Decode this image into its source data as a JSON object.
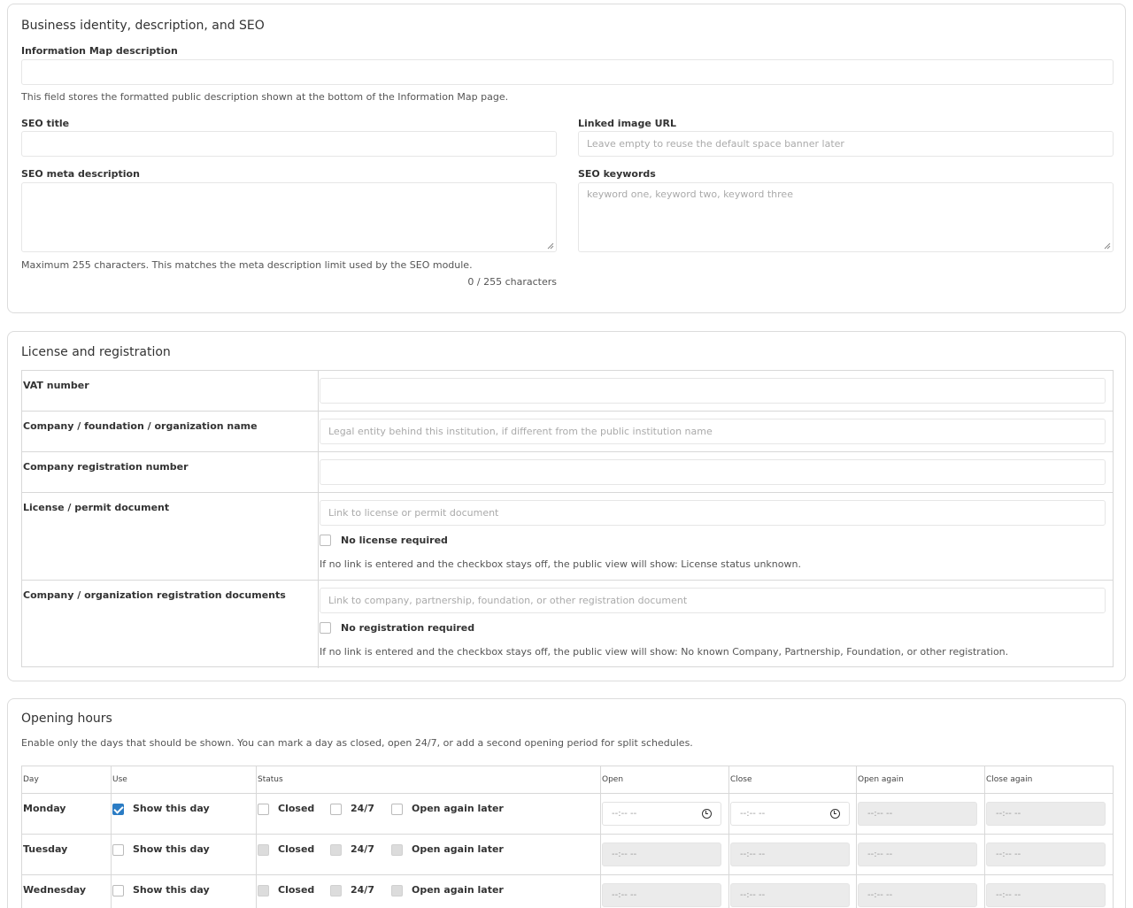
{
  "seo": {
    "title": "Business identity, description, and SEO",
    "info_map_label": "Information Map description",
    "info_map_value": "",
    "info_map_help": "This field stores the formatted public description shown at the bottom of the Information Map page.",
    "seo_title_label": "SEO title",
    "seo_title_value": "",
    "linked_image_label": "Linked image URL",
    "linked_image_placeholder": "Leave empty to reuse the default space banner later",
    "meta_desc_label": "SEO meta description",
    "meta_desc_value": "",
    "keywords_label": "SEO keywords",
    "keywords_placeholder": "keyword one, keyword two, keyword three",
    "meta_help": "Maximum 255 characters. This matches the meta description limit used by the SEO module.",
    "char_count": "0 / 255 characters"
  },
  "license": {
    "title": "License and registration",
    "rows": {
      "vat": {
        "label": "VAT number",
        "placeholder": ""
      },
      "company_name": {
        "label": "Company / foundation / organization name",
        "placeholder": "Legal entity behind this institution, if different from the public institution name"
      },
      "reg_number": {
        "label": "Company registration number",
        "placeholder": ""
      },
      "permit": {
        "label": "License / permit document",
        "placeholder": "Link to license or permit document",
        "checkbox": "No license required",
        "help": "If no link is entered and the checkbox stays off, the public view will show: License status unknown."
      },
      "reg_docs": {
        "label": "Company / organization registration documents",
        "placeholder": "Link to company, partnership, foundation, or other registration document",
        "checkbox": "No registration required",
        "help": "If no link is entered and the checkbox stays off, the public view will show: No known Company, Partnership, Foundation, or other registration."
      }
    }
  },
  "hours": {
    "title": "Opening hours",
    "help": "Enable only the days that should be shown. You can mark a day as closed, open 24/7, or add a second opening period for split schedules.",
    "headers": {
      "day": "Day",
      "use": "Use",
      "status": "Status",
      "open": "Open",
      "close": "Close",
      "open_again": "Open again",
      "close_again": "Close again"
    },
    "show_label": "Show this day",
    "closed_label": "Closed",
    "always_label": "24/7",
    "again_label": "Open again later",
    "time_placeholder": "--:-- --",
    "days": [
      {
        "name": "Monday",
        "enabled": true
      },
      {
        "name": "Tuesday",
        "enabled": false
      },
      {
        "name": "Wednesday",
        "enabled": false
      }
    ]
  },
  "colors": {
    "accent": "#2b7cc4"
  }
}
